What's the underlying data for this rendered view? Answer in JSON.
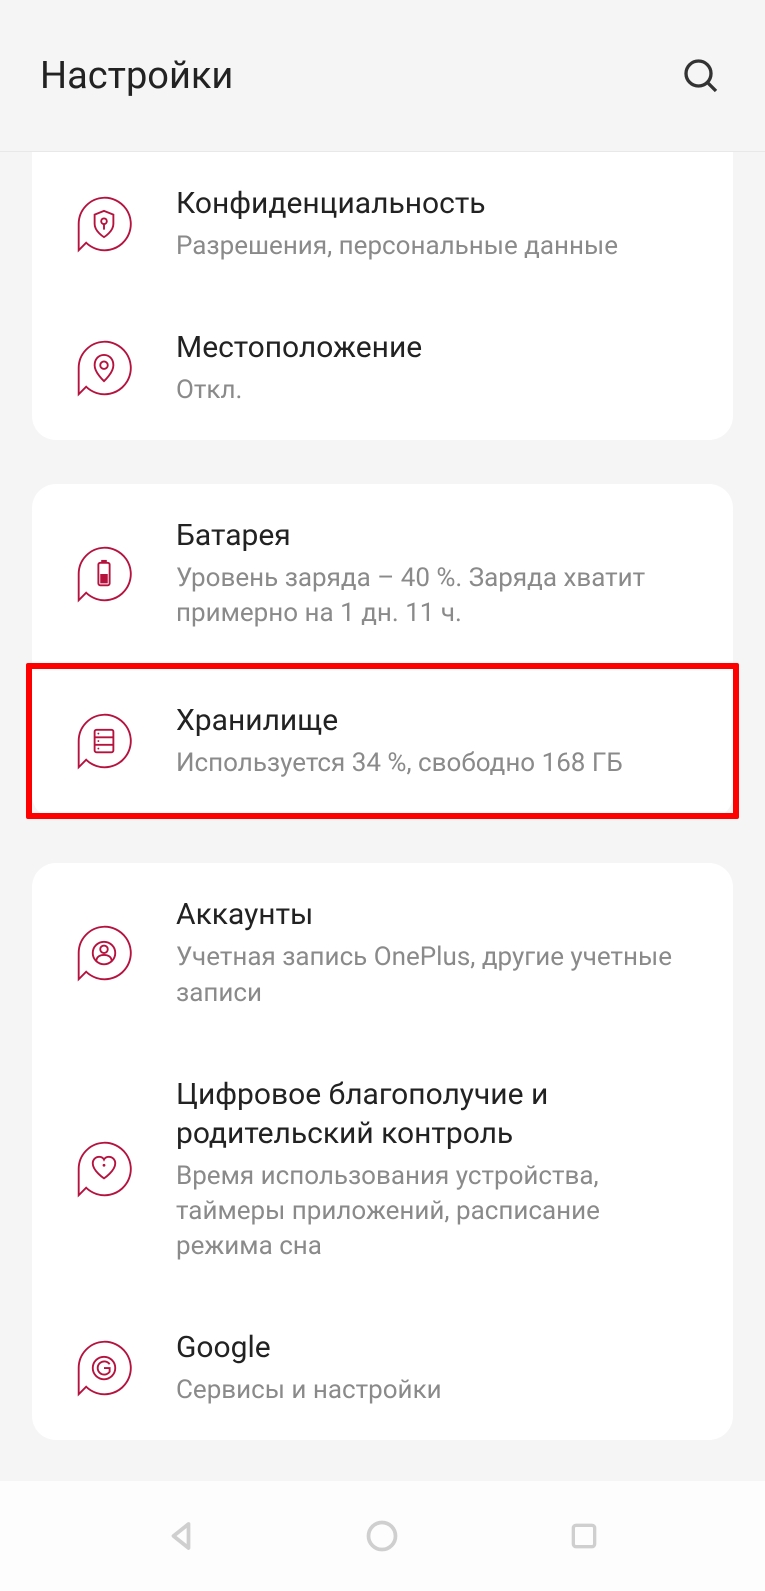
{
  "header": {
    "title": "Настройки"
  },
  "groups": [
    {
      "items": [
        {
          "icon": "shield-key-icon",
          "title": "Конфиденциальность",
          "sub": "Разрешения, персональные данные"
        },
        {
          "icon": "location-pin-icon",
          "title": "Местоположение",
          "sub": "Откл."
        }
      ]
    },
    {
      "items": [
        {
          "icon": "battery-icon",
          "title": "Батарея",
          "sub": "Уровень заряда – 40 %. Заряда хватит примерно на 1 дн. 11 ч."
        },
        {
          "icon": "storage-icon",
          "title": "Хранилище",
          "sub": "Используется 34 %, свободно 168 ГБ",
          "highlight": true
        }
      ]
    },
    {
      "items": [
        {
          "icon": "account-icon",
          "title": "Аккаунты",
          "sub": "Учетная запись OnePlus, другие учетные записи"
        },
        {
          "icon": "heart-icon",
          "title": "Цифровое благополучие и родительский контроль",
          "sub": "Время использования устройства, таймеры приложений, расписание режима сна"
        },
        {
          "icon": "google-g-icon",
          "title": "Google",
          "sub": "Сервисы и настройки"
        }
      ]
    }
  ]
}
